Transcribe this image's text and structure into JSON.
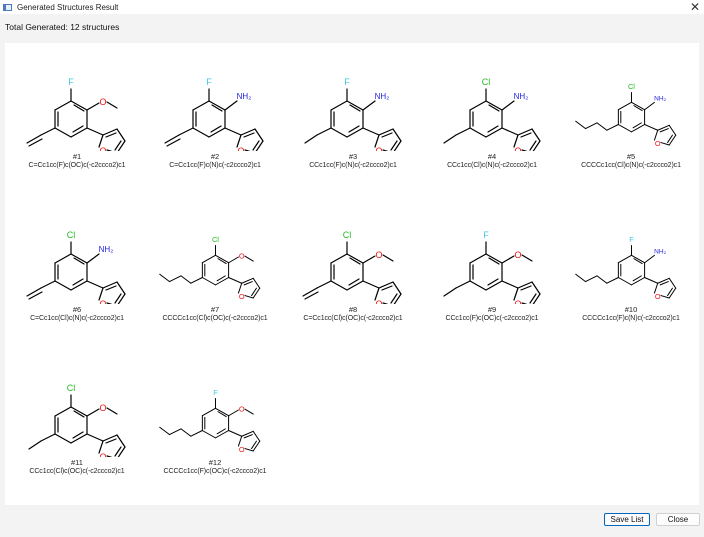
{
  "window": {
    "title": "Generated Structures Result",
    "close_glyph": "✕",
    "app_icon": "window-icon"
  },
  "summary": "Total Generated: 12 structures",
  "structures": [
    {
      "label": "#1",
      "smiles": "C=Cc1cc(F)c(OC)c(-c2ccco2)c1",
      "halogen": "F",
      "subst": "OMe",
      "tail": "vinyl"
    },
    {
      "label": "#2",
      "smiles": "C=Cc1cc(F)c(N)c(-c2ccco2)c1",
      "halogen": "F",
      "subst": "NH2",
      "tail": "vinyl"
    },
    {
      "label": "#3",
      "smiles": "CCc1cc(F)c(N)c(-c2ccco2)c1",
      "halogen": "F",
      "subst": "NH2",
      "tail": "ethyl"
    },
    {
      "label": "#4",
      "smiles": "CCc1cc(Cl)c(N)c(-c2ccco2)c1",
      "halogen": "Cl",
      "subst": "NH2",
      "tail": "ethyl"
    },
    {
      "label": "#5",
      "smiles": "CCCCc1cc(Cl)c(N)c(-c2ccco2)c1",
      "halogen": "Cl",
      "subst": "NH2",
      "tail": "butyl"
    },
    {
      "label": "#6",
      "smiles": "C=Cc1cc(Cl)c(N)c(-c2ccco2)c1",
      "halogen": "Cl",
      "subst": "NH2",
      "tail": "vinyl"
    },
    {
      "label": "#7",
      "smiles": "CCCCc1cc(Cl)c(OC)c(-c2ccco2)c1",
      "halogen": "Cl",
      "subst": "OMe",
      "tail": "butyl"
    },
    {
      "label": "#8",
      "smiles": "C=Cc1cc(Cl)c(OC)c(-c2ccco2)c1",
      "halogen": "Cl",
      "subst": "OMe",
      "tail": "vinyl"
    },
    {
      "label": "#9",
      "smiles": "CCc1cc(F)c(OC)c(-c2ccco2)c1",
      "halogen": "F",
      "subst": "OMe",
      "tail": "ethyl"
    },
    {
      "label": "#10",
      "smiles": "CCCCc1cc(F)c(N)c(-c2ccco2)c1",
      "halogen": "F",
      "subst": "NH2",
      "tail": "butyl"
    },
    {
      "label": "#11",
      "smiles": "CCc1cc(Cl)c(OC)c(-c2ccco2)c1",
      "halogen": "Cl",
      "subst": "OMe",
      "tail": "ethyl"
    },
    {
      "label": "#12",
      "smiles": "CCCCc1cc(F)c(OC)c(-c2ccco2)c1",
      "halogen": "F",
      "subst": "OMe",
      "tail": "butyl"
    }
  ],
  "atom_text": {
    "F": "F",
    "Cl": "Cl",
    "O": "O",
    "NH2": "NH₂"
  },
  "colors": {
    "F": "#3cc8e6",
    "Cl": "#22bb22",
    "N": "#2222dd",
    "O": "#ee1111",
    "bond": "#000000"
  },
  "buttons": {
    "save": "Save List",
    "close": "Close"
  }
}
